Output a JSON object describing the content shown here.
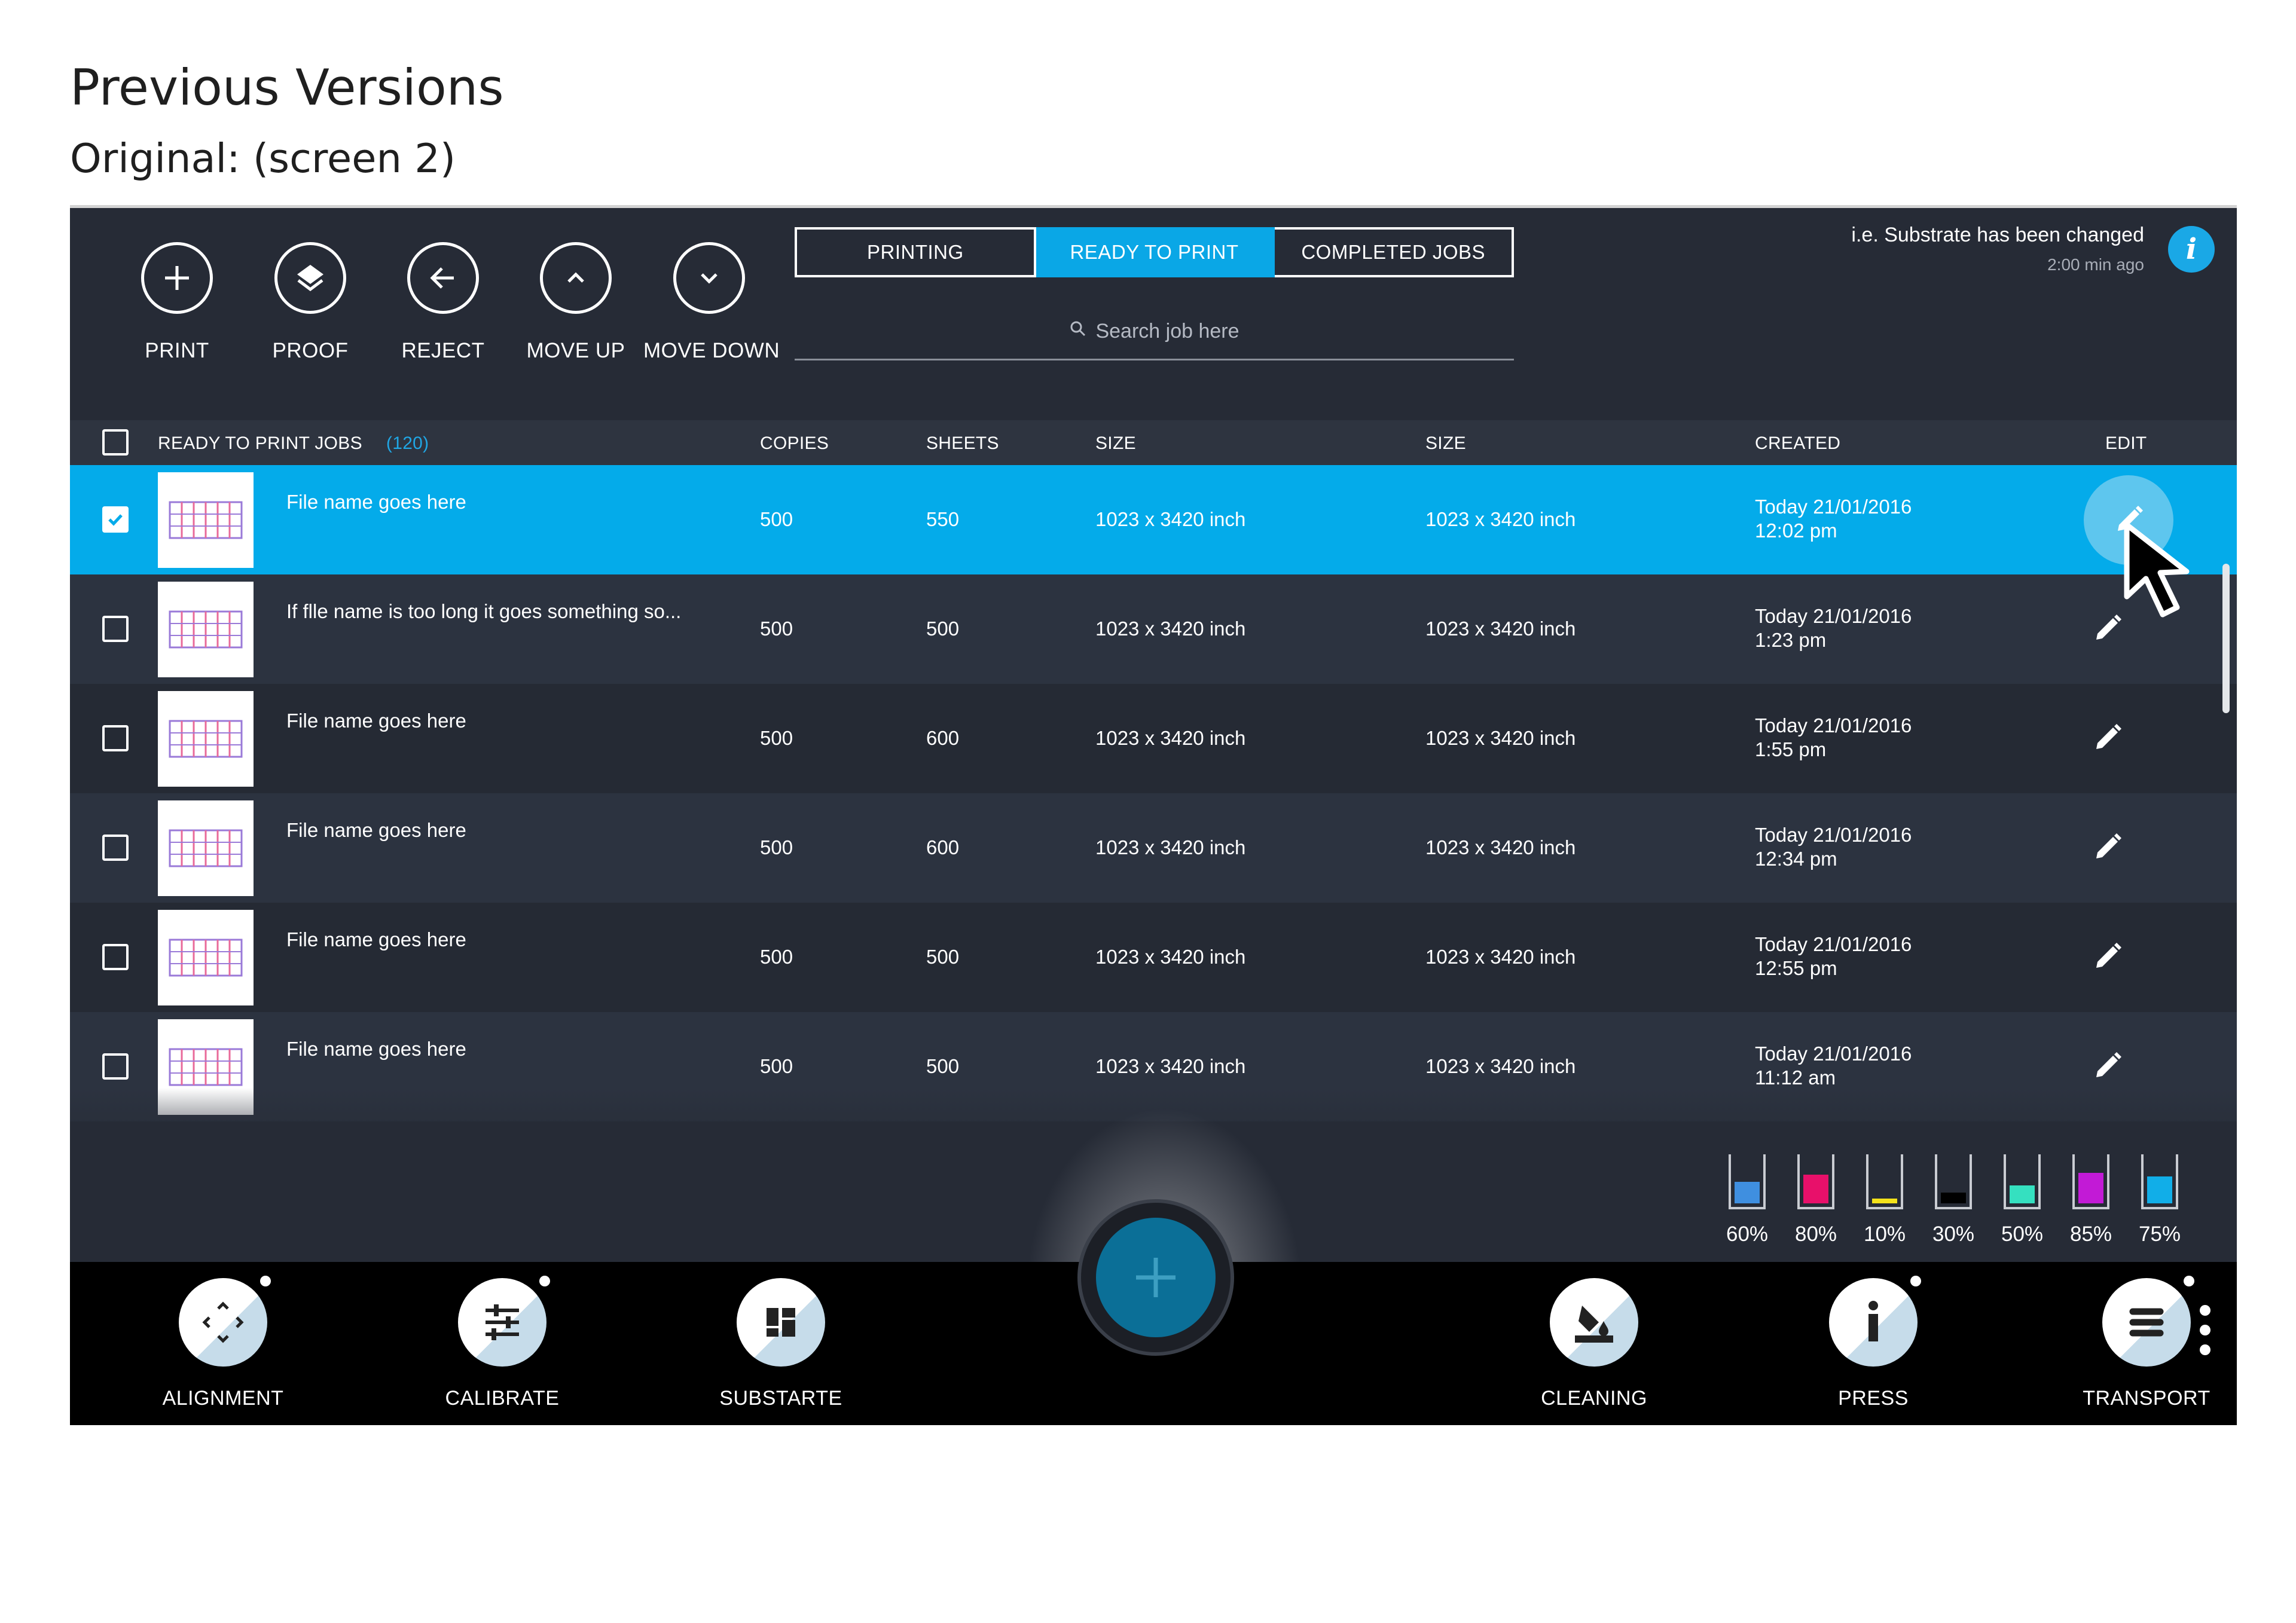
{
  "document": {
    "title": "Previous Versions",
    "subtitle": "Original: (screen 2)"
  },
  "toolbar": {
    "buttons": [
      {
        "label": "PRINT",
        "icon": "plus-icon"
      },
      {
        "label": "PROOF",
        "icon": "layers-icon"
      },
      {
        "label": "REJECT",
        "icon": "arrow-left-icon"
      },
      {
        "label": "MOVE UP",
        "icon": "chevron-up-icon"
      },
      {
        "label": "MOVE DOWN",
        "icon": "chevron-down-icon"
      }
    ]
  },
  "tabs": [
    {
      "label": "PRINTING",
      "active": false
    },
    {
      "label": "READY TO PRINT",
      "active": true
    },
    {
      "label": "COMPLETED JOBS",
      "active": false
    }
  ],
  "search": {
    "placeholder": "Search job here"
  },
  "notification": {
    "message": "i.e. Substrate has been changed",
    "time": "2:00 min ago"
  },
  "table": {
    "headers": {
      "jobs": "READY TO PRINT JOBS",
      "count": "(120)",
      "copies": "COPIES",
      "sheets": "SHEETS",
      "size1": "SIZE",
      "size2": "SIZE",
      "created": "CREATED",
      "edit": "EDIT"
    },
    "rows": [
      {
        "name": "File name goes here",
        "copies": "500",
        "sheets": "550",
        "size1": "1023 x 3420 inch",
        "size2": "1023 x 3420 inch",
        "created_date": "Today 21/01/2016",
        "created_time": "12:02 pm",
        "checked": true
      },
      {
        "name": "If flle name is too long it goes something so...",
        "copies": "500",
        "sheets": "500",
        "size1": "1023 x 3420 inch",
        "size2": "1023 x 3420 inch",
        "created_date": "Today 21/01/2016",
        "created_time": "1:23 pm",
        "checked": false
      },
      {
        "name": "File name goes here",
        "copies": "500",
        "sheets": "600",
        "size1": "1023 x 3420 inch",
        "size2": "1023 x 3420 inch",
        "created_date": "Today 21/01/2016",
        "created_time": "1:55 pm",
        "checked": false
      },
      {
        "name": "File name goes here",
        "copies": "500",
        "sheets": "600",
        "size1": "1023 x 3420 inch",
        "size2": "1023 x 3420 inch",
        "created_date": "Today 21/01/2016",
        "created_time": "12:34 pm",
        "checked": false
      },
      {
        "name": "File name goes here",
        "copies": "500",
        "sheets": "500",
        "size1": "1023 x 3420 inch",
        "size2": "1023 x 3420 inch",
        "created_date": "Today 21/01/2016",
        "created_time": "12:55 pm",
        "checked": false
      },
      {
        "name": "File name goes here",
        "copies": "500",
        "sheets": "500",
        "size1": "1023 x 3420 inch",
        "size2": "1023 x 3420 inch",
        "created_date": "Today 21/01/2016",
        "created_time": "11:12 am",
        "checked": false
      }
    ]
  },
  "inks": [
    {
      "label": "60%",
      "level": 0.6,
      "color": "#3f8fe0"
    },
    {
      "label": "80%",
      "level": 0.8,
      "color": "#e8106a"
    },
    {
      "label": "10%",
      "level": 0.1,
      "color": "#f4e21a"
    },
    {
      "label": "30%",
      "level": 0.3,
      "color": "#000000"
    },
    {
      "label": "50%",
      "level": 0.5,
      "color": "#35e0c0"
    },
    {
      "label": "85%",
      "level": 0.85,
      "color": "#c21ad6"
    },
    {
      "label": "75%",
      "level": 0.75,
      "color": "#11aee8"
    }
  ],
  "bottombar": {
    "items": [
      {
        "label": "ALIGNMENT",
        "icon": "alignment-icon",
        "dot": true
      },
      {
        "label": "CALIBRATE",
        "icon": "sliders-icon",
        "dot": true
      },
      {
        "label": "SUBSTARTE",
        "icon": "substrate-grid-icon",
        "dot": false
      },
      {
        "label": "CLEANING",
        "icon": "paint-bucket-icon",
        "dot": false
      },
      {
        "label": "PRESS",
        "icon": "info-press-icon",
        "dot": true
      },
      {
        "label": "TRANSPORT",
        "icon": "transport-lines-icon",
        "dot": true
      }
    ]
  },
  "colors": {
    "screen_bg": "#262b36",
    "accent": "#0aa7e6",
    "selected_row": "#04abea",
    "bottom_bar": "#000000"
  }
}
